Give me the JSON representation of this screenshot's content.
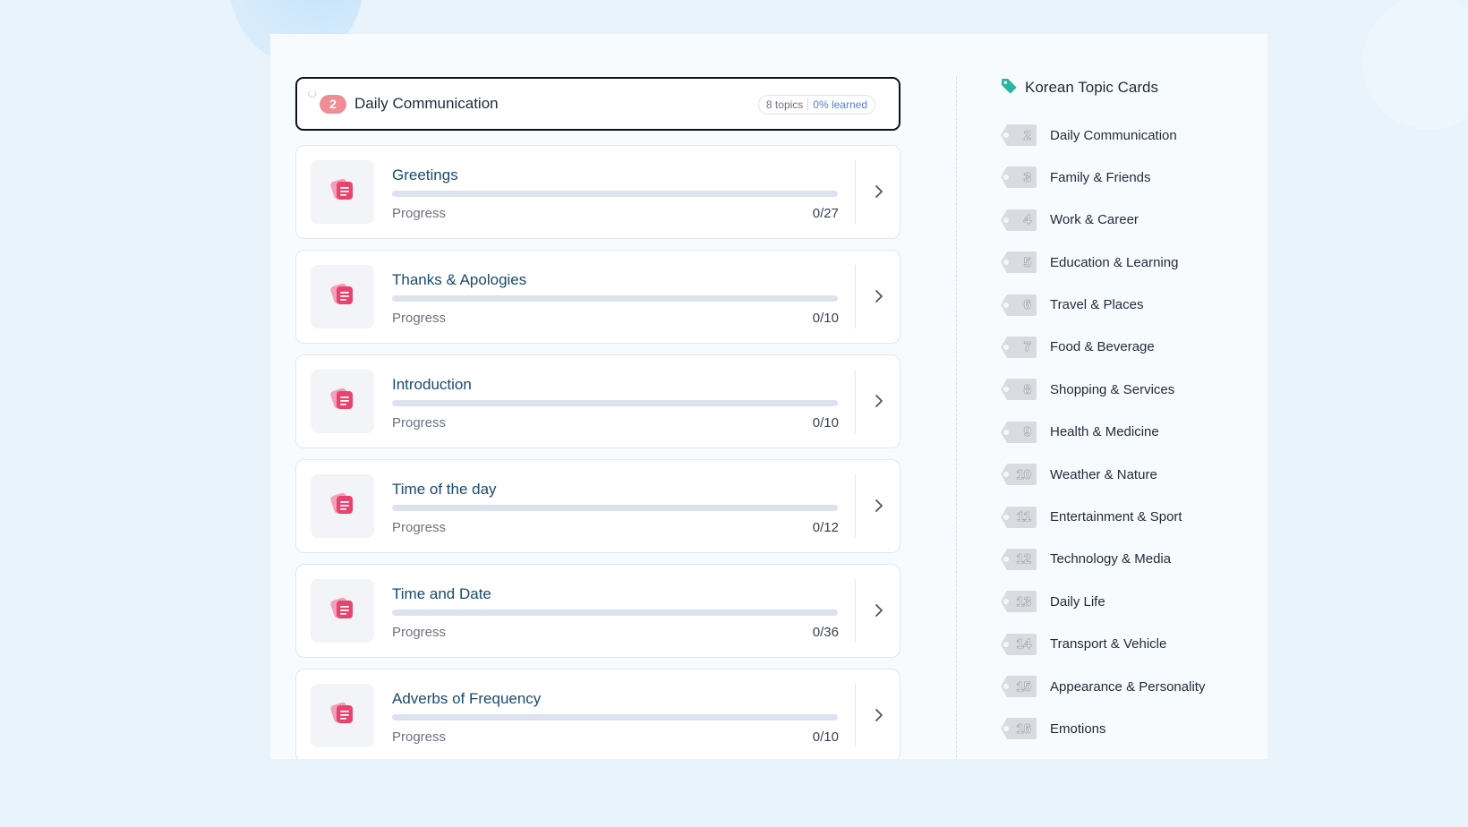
{
  "group": {
    "number": "2",
    "title": "Daily Communication",
    "topics": "8 topics",
    "learned": "0% learned"
  },
  "lessons": [
    {
      "title": "Greetings",
      "progress_label": "Progress",
      "count": "0/27",
      "progress": 0
    },
    {
      "title": "Thanks & Apologies",
      "progress_label": "Progress",
      "count": "0/10",
      "progress": 0
    },
    {
      "title": "Introduction",
      "progress_label": "Progress",
      "count": "0/10",
      "progress": 0
    },
    {
      "title": "Time of the day",
      "progress_label": "Progress",
      "count": "0/12",
      "progress": 0
    },
    {
      "title": "Time and Date",
      "progress_label": "Progress",
      "count": "0/36",
      "progress": 0
    },
    {
      "title": "Adverbs of Frequency",
      "progress_label": "Progress",
      "count": "0/10",
      "progress": 0
    }
  ],
  "sidebar": {
    "title": "Korean Topic Cards",
    "items": [
      {
        "number": "2",
        "label": "Daily Communication"
      },
      {
        "number": "3",
        "label": "Family & Friends"
      },
      {
        "number": "4",
        "label": "Work & Career"
      },
      {
        "number": "5",
        "label": "Education & Learning"
      },
      {
        "number": "6",
        "label": "Travel & Places"
      },
      {
        "number": "7",
        "label": "Food & Beverage"
      },
      {
        "number": "8",
        "label": "Shopping & Services"
      },
      {
        "number": "9",
        "label": "Health & Medicine"
      },
      {
        "number": "10",
        "label": "Weather & Nature"
      },
      {
        "number": "11",
        "label": "Entertainment & Sport"
      },
      {
        "number": "12",
        "label": "Technology & Media"
      },
      {
        "number": "13",
        "label": "Daily Life"
      },
      {
        "number": "14",
        "label": "Transport & Vehicle"
      },
      {
        "number": "15",
        "label": "Appearance & Personality"
      },
      {
        "number": "16",
        "label": "Emotions"
      }
    ]
  },
  "icons": {
    "lesson": "flashcards-icon",
    "chevron": "chevron-right-icon",
    "tag": "tag-icon",
    "spinner": "loading-spinner-icon"
  },
  "colors": {
    "accent_pink": "#e8436e",
    "group_badge": "#f08c94",
    "learned_blue": "#4f7fd8",
    "title_teal": "#1a4a6b",
    "tag_icon": "#2bb3a3"
  }
}
